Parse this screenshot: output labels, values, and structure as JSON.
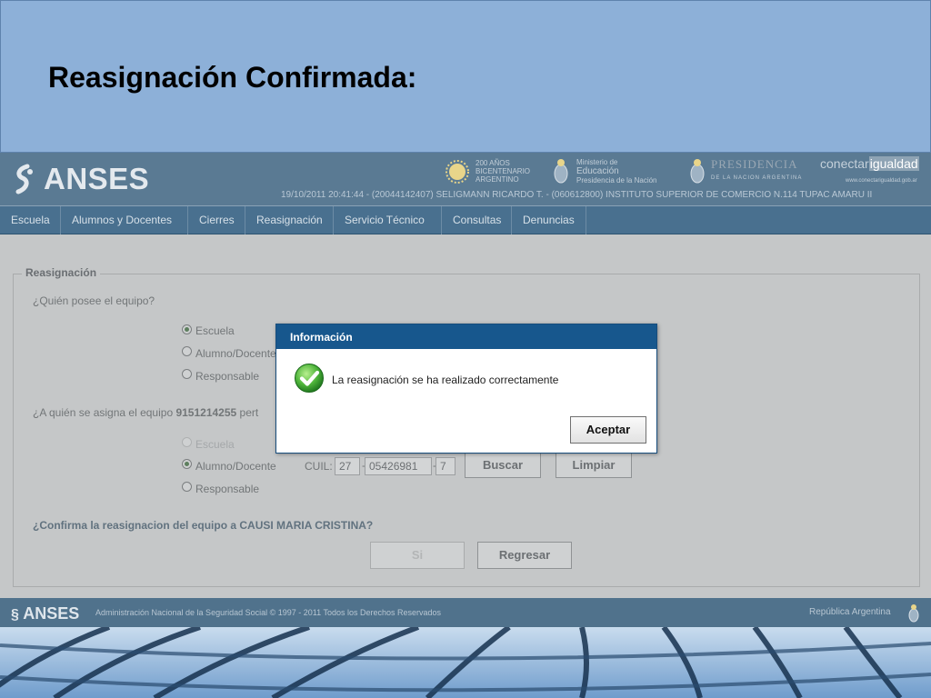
{
  "slide": {
    "title": "Reasignación Confirmada:"
  },
  "header": {
    "brand": "ANSES",
    "session_info": "19/10/2011 20:41:44 - (20044142407) SELIGMANN RICARDO T. - (060612800) INSTITUTO SUPERIOR DE COMERCIO N.114 TUPAC AMARU II",
    "bicentenario": [
      "200 AÑOS",
      "BICENTENARIO",
      "ARGENTINO"
    ],
    "ministerio": [
      "Ministerio de",
      "Educación",
      "Presidencia de la Nación"
    ],
    "presidencia": "PRESIDENCIA",
    "presidencia_sub": "DE LA NACION ARGENTINA",
    "conectar_a": "conectar",
    "conectar_b": "igualdad",
    "conectar_url": "www.conectarigualdad.gob.ar"
  },
  "nav": {
    "items": [
      {
        "label": "Escuela"
      },
      {
        "label": "Alumnos y Docentes"
      },
      {
        "label": "Cierres"
      },
      {
        "label": "Reasignación"
      },
      {
        "label": "Servicio Técnico"
      },
      {
        "label": "Consultas"
      },
      {
        "label": "Denuncias"
      }
    ]
  },
  "form": {
    "legend": "Reasignación",
    "q1": "¿Quién posee el equipo?",
    "owner_options": [
      {
        "label": "Escuela",
        "checked": true
      },
      {
        "label": "Alumno/Docente",
        "checked": false
      },
      {
        "label": "Responsable",
        "checked": false
      }
    ],
    "q2_prefix": "¿A quién se asigna el equipo ",
    "q2_serial": "9151214255",
    "q2_suffix": " pert",
    "assign_options": [
      {
        "label": "Escuela",
        "checked": false,
        "disabled": true
      },
      {
        "label": "Alumno/Docente",
        "checked": true,
        "disabled": false
      },
      {
        "label": "Responsable",
        "checked": false,
        "disabled": false
      }
    ],
    "cuil_label": "CUIL:",
    "cuil_part1": "27",
    "cuil_part2": "05426981",
    "cuil_part3": "7",
    "dash": "-",
    "search_button": "Buscar",
    "clear_button": "Limpiar",
    "confirm_question": "¿Confirma la reasignacion del equipo a CAUSI MARIA CRISTINA?",
    "yes_button": "Si",
    "back_button": "Regresar"
  },
  "footer": {
    "brand": "ANSES",
    "text": "Administración Nacional de la Seguridad Social © 1997 - 2011 Todos los Derechos Reservados",
    "right": "República Argentina"
  },
  "dialog": {
    "title": "Información",
    "message": "La reasignación se ha realizado correctamente",
    "ok_button": "Aceptar"
  },
  "colors": {
    "slide_bg": "#8db0d8",
    "header_bg": "#5a7a93",
    "nav_bg": "#49708f",
    "dialog_header": "#17578d",
    "success_green": "#3aa335"
  }
}
